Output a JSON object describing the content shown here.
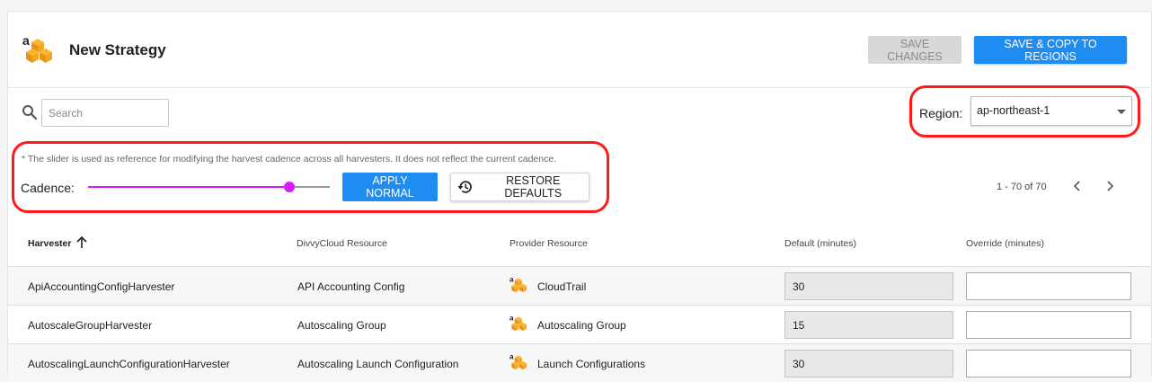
{
  "header": {
    "title": "New Strategy",
    "save_changes_label": "SAVE CHANGES",
    "save_copy_label": "SAVE & COPY TO REGIONS",
    "logo_icon": "aws-logo-icon"
  },
  "search": {
    "placeholder": "Search"
  },
  "region": {
    "label": "Region:",
    "selected": "ap-northeast-1"
  },
  "cadence": {
    "note": "* The slider is used as reference for modifying the harvest cadence across all harvesters. It does not reflect the current cadence.",
    "label": "Cadence:",
    "slider_level": 0.84,
    "apply_label": "APPLY NORMAL",
    "restore_label": "RESTORE DEFAULTS"
  },
  "pagination": {
    "text": "1 - 70 of 70"
  },
  "table": {
    "columns": [
      "Harvester",
      "DivvyCloud Resource",
      "Provider Resource",
      "Default (minutes)",
      "Override (minutes)"
    ],
    "rows": [
      {
        "harvester": "ApiAccountingConfigHarvester",
        "resource": "API Accounting Config",
        "provider": "CloudTrail",
        "default": "30",
        "override": ""
      },
      {
        "harvester": "AutoscaleGroupHarvester",
        "resource": "Autoscaling Group",
        "provider": "Autoscaling Group",
        "default": "15",
        "override": ""
      },
      {
        "harvester": "AutoscalingLaunchConfigurationHarvester",
        "resource": "Autoscaling Launch Configuration",
        "provider": "Launch Configurations",
        "default": "30",
        "override": ""
      }
    ]
  },
  "colors": {
    "primary": "#1e8cf0",
    "slider": "#d81bff",
    "highlight": "#ff1a1a",
    "aws_orange": "#f5a623"
  }
}
